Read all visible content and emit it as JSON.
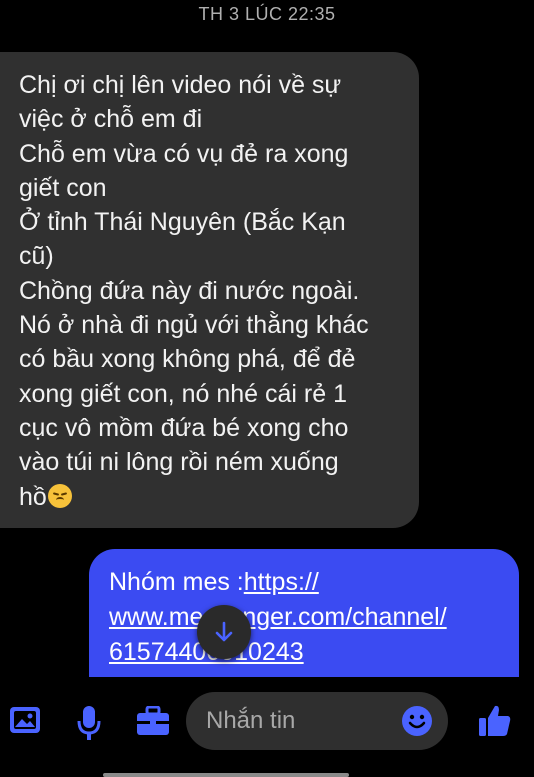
{
  "timestamp": "TH 3 LÚC 22:35",
  "incoming_message": {
    "lines": [
      "Chị ơi chị lên video nói về sự",
      "việc ở chỗ em đi",
      "Chỗ em vừa có vụ đẻ ra xong",
      "giết con",
      "Ở tỉnh Thái Nguyên (Bắc Kạn",
      "cũ)",
      "Chồng đứa này đi nước ngoài.",
      "Nó ở nhà đi ngủ với thằng khác",
      "có bầu xong không phá, để đẻ",
      "xong giết con, nó nhé cái rẻ 1",
      "cục vô mồm đứa bé xong cho",
      "vào túi ni lông rồi ném xuống",
      "hồ"
    ],
    "trailing_emoji": "sad-face-emoji"
  },
  "outgoing_message": {
    "prefix": "Nhóm mes :",
    "link_lines": [
      "https://",
      "www.messenger.com/channel/",
      "61574400010243"
    ]
  },
  "composer": {
    "placeholder": "Nhắn tin",
    "icons": [
      "image-icon",
      "microphone-icon",
      "briefcase-icon",
      "emoji-icon",
      "thumbs-up-icon"
    ]
  },
  "colors": {
    "incoming_bubble": "#303030",
    "outgoing_bubble": "#3b4bf2",
    "accent_icon": "#4a63ff"
  }
}
